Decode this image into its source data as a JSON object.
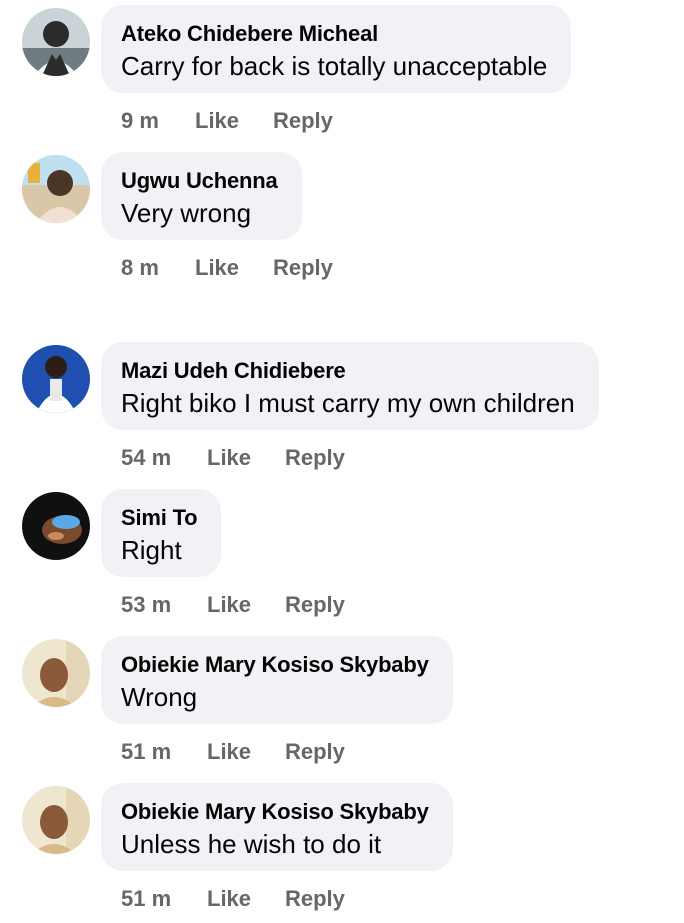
{
  "comments": [
    {
      "author": "Ateko Chidebere Micheal",
      "text": "Carry for back is totally unacceptable",
      "time": "9 m",
      "like_label": "Like",
      "reply_label": "Reply",
      "avatar_colors": [
        "#c9d3d8",
        "#2b2b2b",
        "#f4f4f4"
      ]
    },
    {
      "author": "Ugwu Uchenna",
      "text": "Very wrong",
      "time": "8 m",
      "like_label": "Like",
      "reply_label": "Reply",
      "avatar_colors": [
        "#d9c7a8",
        "#4a3526",
        "#f2e0d2"
      ]
    },
    {
      "author": "Mazi Udeh Chidiebere",
      "text": "Right biko I must carry my own children",
      "time": "54 m",
      "like_label": "Like",
      "reply_label": "Reply",
      "avatar_colors": [
        "#1f4fb0",
        "#2c1d15",
        "#ffffff"
      ]
    },
    {
      "author": "Simi To",
      "text": "Right",
      "time": "53 m",
      "like_label": "Like",
      "reply_label": "Reply",
      "avatar_colors": [
        "#101010",
        "#7a4a2a",
        "#5aa8e8"
      ]
    },
    {
      "author": "Obiekie Mary Kosiso Skybaby",
      "text": "Wrong",
      "time": "51 m",
      "like_label": "Like",
      "reply_label": "Reply",
      "avatar_colors": [
        "#efe6cf",
        "#8a5a3a",
        "#d9b88a"
      ]
    },
    {
      "author": "Obiekie Mary Kosiso Skybaby",
      "text": "Unless he wish to do it",
      "time": "51 m",
      "like_label": "Like",
      "reply_label": "Reply",
      "avatar_colors": [
        "#efe6cf",
        "#8a5a3a",
        "#d9b88a"
      ]
    }
  ]
}
